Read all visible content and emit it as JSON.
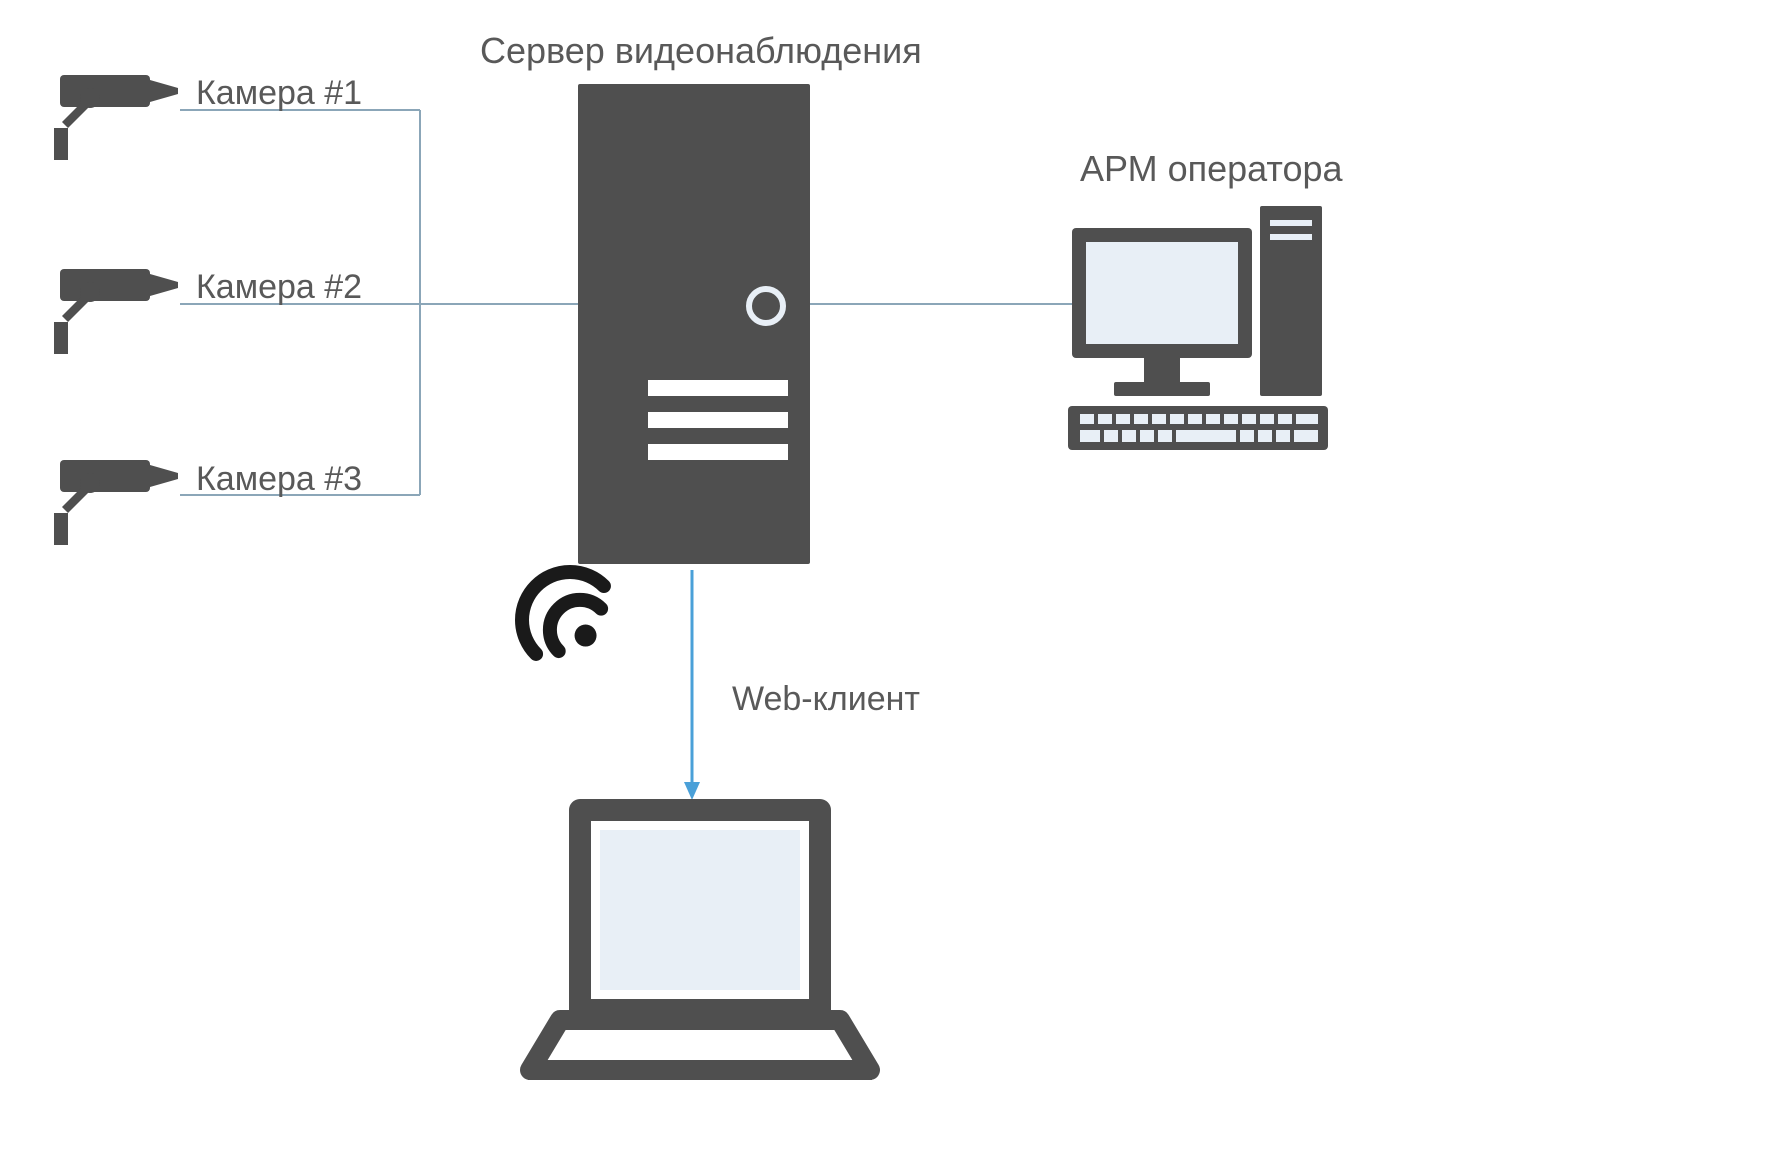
{
  "cameras": [
    {
      "label": "Камера #1"
    },
    {
      "label": "Камера #2"
    },
    {
      "label": "Камера #3"
    }
  ],
  "server": {
    "title": "Сервер видеонаблюдения"
  },
  "workstation": {
    "title": "АРМ оператора"
  },
  "webclient": {
    "title": "Web-клиент"
  },
  "colors": {
    "iconDark": "#4f4f4f",
    "iconBlack": "#1a1a1a",
    "screenFill": "#e8eff6",
    "line": "#8ba6b8",
    "arrow": "#4aa0d8",
    "text": "#595959"
  }
}
